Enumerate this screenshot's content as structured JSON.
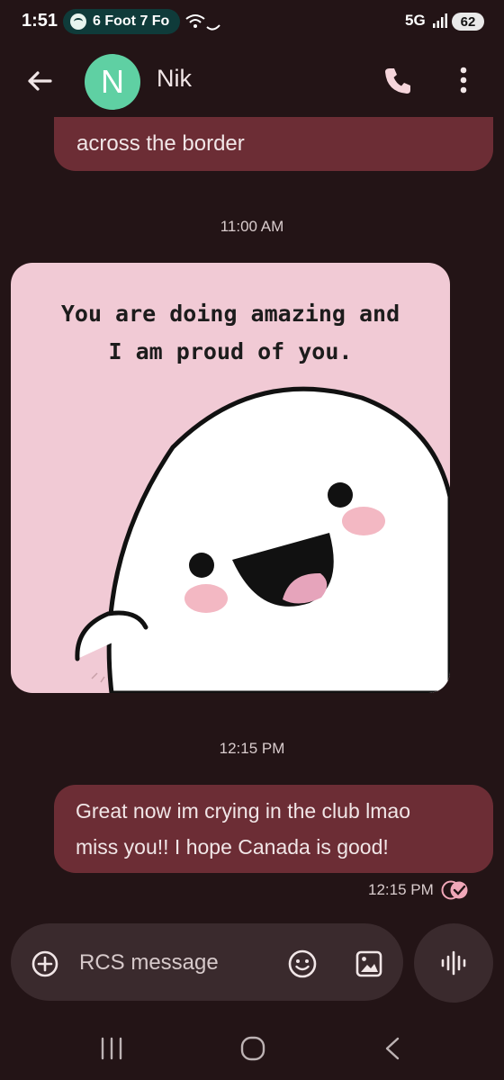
{
  "status_bar": {
    "time": "1:51",
    "now_playing": "6 Foot 7 Fo",
    "network": "5G",
    "battery": "62"
  },
  "header": {
    "avatar_letter": "N",
    "contact_name": "Nik",
    "icons": [
      "back-arrow-icon",
      "phone-icon",
      "more-vert-icon"
    ]
  },
  "messages": {
    "prev_incoming_text": "across the border",
    "timestamp_1": "11:00 AM",
    "image_caption_line1": "You are doing amazing and",
    "image_caption_line2": "I am proud of you.",
    "timestamp_2": "12:15 PM",
    "outgoing_line1": "Great now im crying in the club lmao",
    "outgoing_line2": "miss you!! I hope Canada is good!",
    "outgoing_time": "12:15 PM"
  },
  "composer": {
    "placeholder": "RCS message",
    "icons": [
      "add-icon",
      "emoji-icon",
      "gallery-icon",
      "voice-icon"
    ]
  },
  "colors": {
    "background": "#231416",
    "bubble": "#6c2d35",
    "avatar": "#5fd0a3",
    "image_bg": "#f1cad5",
    "composer": "#3a2a2d"
  }
}
